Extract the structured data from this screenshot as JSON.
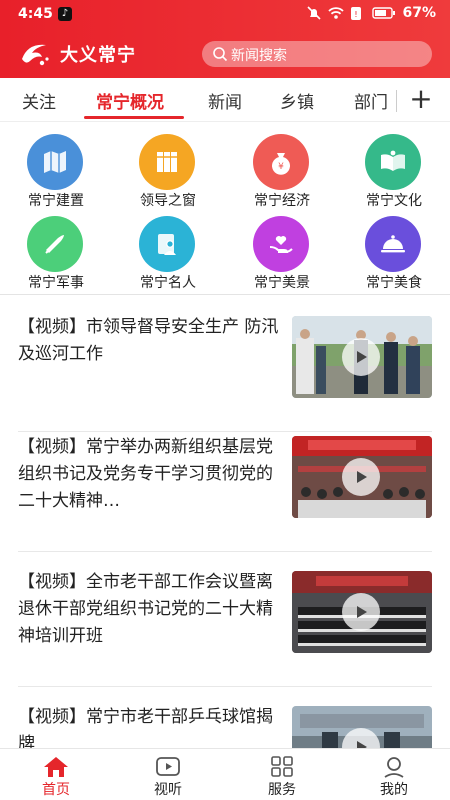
{
  "status_bar": {
    "time": "4:45",
    "battery": "67%"
  },
  "app": {
    "title": "大义常宁"
  },
  "search": {
    "placeholder": "新闻搜索"
  },
  "tabs": [
    {
      "label": "关注"
    },
    {
      "label": "常宁概况"
    },
    {
      "label": "新闻"
    },
    {
      "label": "乡镇"
    },
    {
      "label": "部门"
    }
  ],
  "tab_add_label": "+",
  "grid": [
    {
      "label": "常宁建置",
      "icon": "map-icon",
      "color": "#4a90d9"
    },
    {
      "label": "领导之窗",
      "icon": "books-icon",
      "color": "#f5a623"
    },
    {
      "label": "常宁经济",
      "icon": "money-bag-icon",
      "color": "#ef5b55"
    },
    {
      "label": "常宁文化",
      "icon": "open-book-icon",
      "color": "#35b98a"
    },
    {
      "label": "常宁军事",
      "icon": "bullet-icon",
      "color": "#4ccf7a"
    },
    {
      "label": "常宁名人",
      "icon": "person-card-icon",
      "color": "#2bb3d6"
    },
    {
      "label": "常宁美景",
      "icon": "heart-hand-icon",
      "color": "#c040e0"
    },
    {
      "label": "常宁美食",
      "icon": "food-cloche-icon",
      "color": "#6a4fdc"
    }
  ],
  "news": [
    {
      "title": "【视频】市领导督导安全生产 防汛及巡河工作"
    },
    {
      "title": "【视频】常宁举办两新组织基层党组织书记及党务专干学习贯彻党的二十大精神…"
    },
    {
      "title": "【视频】全市老干部工作会议暨离退休干部党组织书记党的二十大精神培训开班"
    },
    {
      "title": "【视频】常宁市老干部乒乓球馆揭牌"
    }
  ],
  "bottom_nav": [
    {
      "label": "首页",
      "icon": "home-icon"
    },
    {
      "label": "视听",
      "icon": "video-icon"
    },
    {
      "label": "服务",
      "icon": "grid-icon"
    },
    {
      "label": "我的",
      "icon": "user-icon"
    }
  ],
  "colors": {
    "brand_red": "#e5262b"
  }
}
